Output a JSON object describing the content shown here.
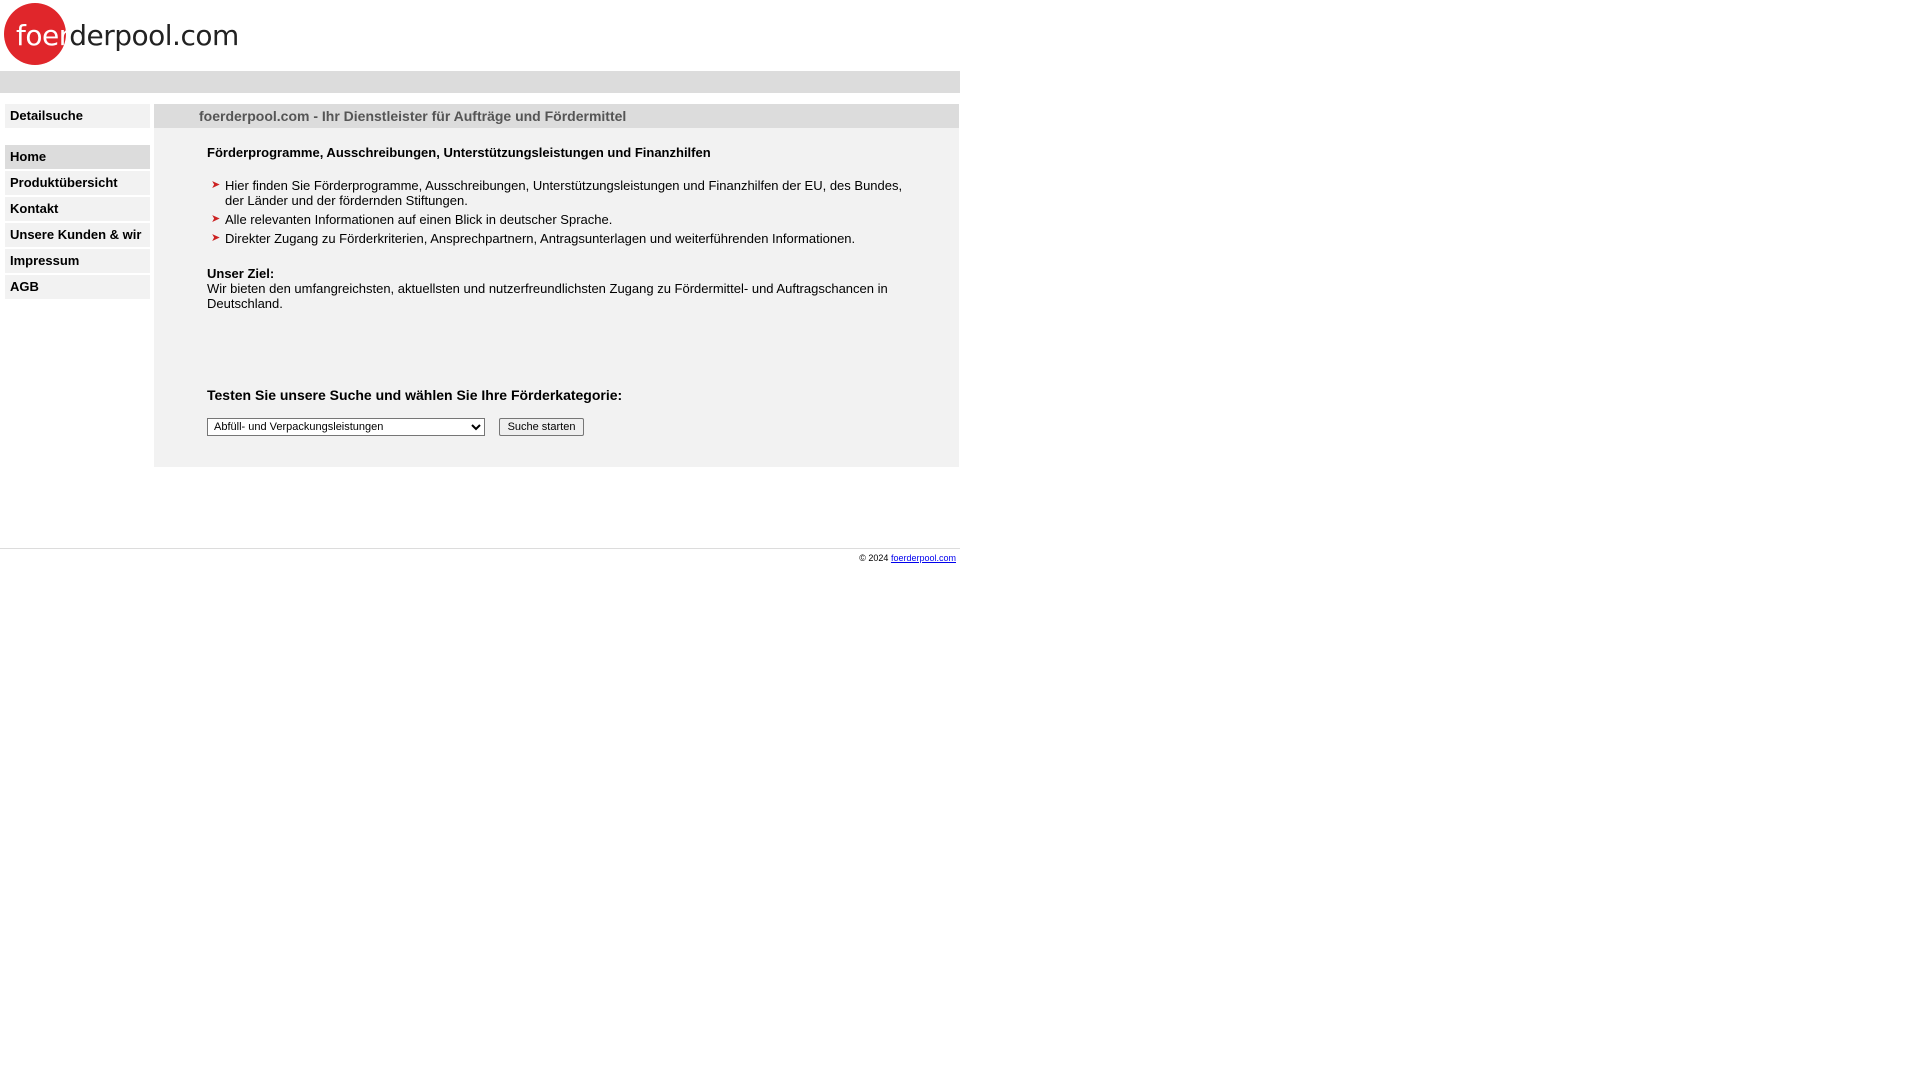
{
  "logo": {
    "text_white": "foer",
    "text_dark": "derpool.com",
    "circle_color": "#e0262b"
  },
  "sidebar": {
    "items": [
      {
        "label": "Detailsuche"
      },
      {
        "label": "Home",
        "active": true
      },
      {
        "label": "Produktübersicht"
      },
      {
        "label": "Kontakt"
      },
      {
        "label": "Unsere Kunden & wir"
      },
      {
        "label": "Impressum"
      },
      {
        "label": "AGB"
      }
    ]
  },
  "main": {
    "title": "foerderpool.com - Ihr Dienstleister für Aufträge und Fördermittel",
    "heading": "Förderprogramme, Ausschreibungen, Unterstützungsleistungen und Finanzhilfen",
    "bullets": [
      "Hier finden Sie Förderprogramme, Ausschreibungen, Unterstützungsleistungen und Finanzhilfen der EU, des Bundes, der Länder und der fördernden Stiftungen.",
      "Alle relevanten Informationen auf einen Blick in deutscher Sprache.",
      "Direkter Zugang zu Förderkriterien, Ansprechpartnern, Antragsunterlagen und weiterführenden Informationen."
    ],
    "goal_title": "Unser Ziel:",
    "goal_text": "Wir bieten den umfangreichsten, aktuellsten und nutzerfreundlichsten Zugang zu Fördermittel- und Auftragschancen in Deutschland.",
    "search": {
      "heading": "Testen Sie unsere Suche und wählen Sie Ihre Förderkategorie:",
      "selected_category": "Abfüll- und Verpackungsleistungen",
      "button_label": "Suche starten"
    }
  },
  "footer": {
    "copyright": "© 2024",
    "link_text": "foerderpool.com"
  },
  "colors": {
    "bar": "#dcdcdc",
    "panel": "#f2f2f2",
    "accent": "#e0262b",
    "arrow": "#cc2222",
    "link": "#0000ee"
  },
  "icons": {
    "bullet": "arrow-right-icon"
  }
}
